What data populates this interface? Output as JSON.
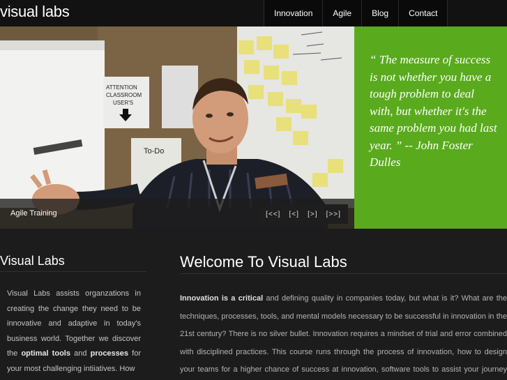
{
  "header": {
    "logo": "visual labs",
    "nav": [
      "Innovation",
      "Agile",
      "Blog",
      "Contact"
    ]
  },
  "slideshow": {
    "caption": "Agile Training",
    "controls": {
      "first": "[<<]",
      "prev": "[<]",
      "next": "[>]",
      "last": "[>>]"
    },
    "photo_text": {
      "sign1": "ATTENTION",
      "sign2": "CLASSROOM",
      "sign3": "USER'S",
      "todo": "To-Do"
    }
  },
  "quote": {
    "text": "“ The measure of success is not whether you have a tough problem to deal with, but whether it's the same problem you had last year. ” -- John Foster Dulles"
  },
  "sidebar": {
    "title": "Visual Labs",
    "p1": "Visual Labs assists organzations in creating the change they need to be innovative and adaptive in today's business world. Together we discover the ",
    "bold1": "optimal tools",
    "p2": " and ",
    "bold2": "processes",
    "p3": " for your most challenging intiiatives. How"
  },
  "main": {
    "title": "Welcome To Visual Labs",
    "bold_lead": "Innovation is a critical",
    "body": " and defining quality in companies today, but what is it?  What are the techniques, processes, tools, and mental models necessary to be successful in innovation in the 21st century?  There is no silver bullet. Innovation requires a mindset of trial and error combined with disciplined practices. This course runs through the process of innovation, how to design your teams for a higher chance of success at innovation, software tools to assist your journey into"
  },
  "colors": {
    "accent": "#5aaa1e",
    "background": "#1c1c1c",
    "header": "#121212"
  }
}
